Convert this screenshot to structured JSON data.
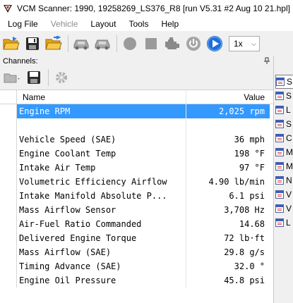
{
  "window": {
    "title": "VCM Scanner: 1990, 19258269_LS376_R8 [run V5.31  #2    Aug 10   21.hpl]"
  },
  "menu": [
    {
      "label": "Log File",
      "enabled": true
    },
    {
      "label": "Vehicle",
      "enabled": false
    },
    {
      "label": "Layout",
      "enabled": true
    },
    {
      "label": "Tools",
      "enabled": true
    },
    {
      "label": "Help",
      "enabled": true
    }
  ],
  "toolbar": {
    "buttons": [
      "open-folder-icon",
      "save-disk-icon",
      "open-log-icon",
      "vehicle-connect-icon",
      "vehicle-disconnect-icon",
      "record-icon",
      "stop-icon",
      "engine-icon",
      "power-icon",
      "play-icon"
    ],
    "zoom": {
      "value": "1x",
      "options": [
        "1x"
      ]
    }
  },
  "channels": {
    "title": "Channels:",
    "columns": {
      "name": "Name",
      "value": "Value"
    },
    "rows": [
      {
        "name": "Engine RPM",
        "value": "2,025 rpm",
        "selected": true
      },
      {
        "name": "",
        "value": "",
        "selected": false
      },
      {
        "name": "Vehicle Speed (SAE)",
        "value": "36 mph",
        "selected": false
      },
      {
        "name": "Engine Coolant Temp",
        "value": "198 °F",
        "selected": false
      },
      {
        "name": "Intake Air Temp",
        "value": "97 °F",
        "selected": false
      },
      {
        "name": "Volumetric Efficiency Airflow",
        "value": "4.90 lb/min",
        "selected": false
      },
      {
        "name": "Intake Manifold Absolute P...",
        "value": "6.1 psi",
        "selected": false
      },
      {
        "name": "Mass Airflow Sensor",
        "value": "3,708 Hz",
        "selected": false
      },
      {
        "name": "Air-Fuel Ratio Commanded",
        "value": "14.68",
        "selected": false
      },
      {
        "name": "Delivered Engine Torque",
        "value": "72 lb·ft",
        "selected": false
      },
      {
        "name": "Mass Airflow (SAE)",
        "value": "29.8 g/s",
        "selected": false
      },
      {
        "name": "Timing Advance (SAE)",
        "value": "32.0 °",
        "selected": false
      },
      {
        "name": "Engine Oil Pressure",
        "value": "45.8 psi",
        "selected": false
      }
    ]
  },
  "right_strip": [
    {
      "label": "S",
      "active": true
    },
    {
      "label": "S",
      "active": false
    },
    {
      "label": "L",
      "active": false
    },
    {
      "label": "S",
      "active": false
    },
    {
      "label": "C",
      "active": false
    },
    {
      "label": "M",
      "active": false
    },
    {
      "label": "M",
      "active": false
    },
    {
      "label": "N",
      "active": false
    },
    {
      "label": "V",
      "active": false
    },
    {
      "label": "V",
      "active": false
    },
    {
      "label": "L",
      "active": false
    }
  ],
  "colors": {
    "selection": "#3399ff",
    "play": "#1e6fd9"
  }
}
